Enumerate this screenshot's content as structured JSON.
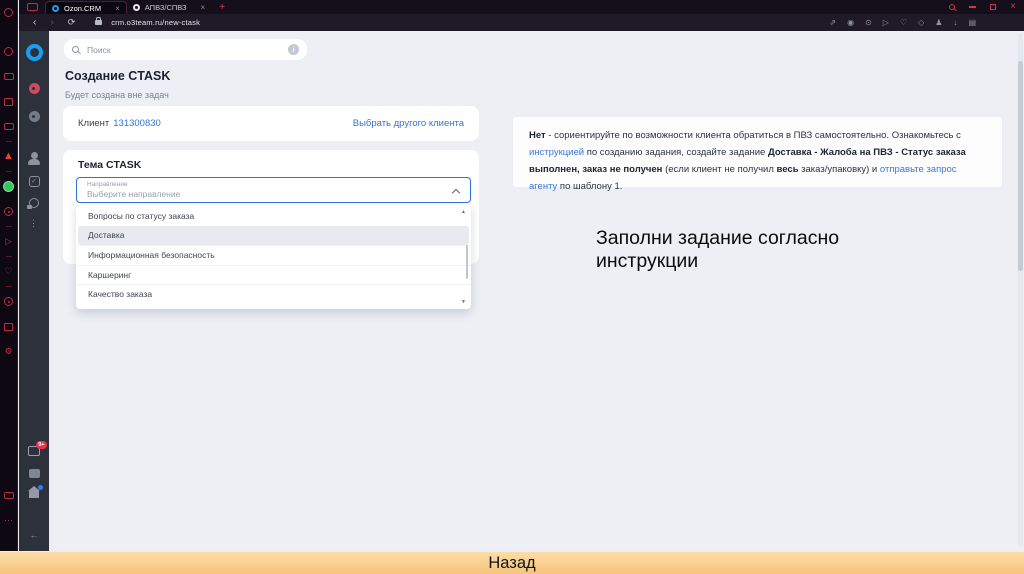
{
  "browser": {
    "tabs": [
      {
        "title": "Ozon.CRM",
        "close": "×"
      },
      {
        "title": "АПВЗ/СПВЗ",
        "close": "×"
      }
    ],
    "new_tab_label": "+",
    "controls": {
      "minimize": "–",
      "close": "×"
    },
    "nav": {
      "back": "‹",
      "forward": "›",
      "reload": "⟳",
      "url": "crm.o3team.ru/new-ctask"
    },
    "toolbar_icons": [
      "⇗",
      "◉",
      "⊙",
      "▷",
      "♡",
      "◇",
      "♟",
      "↓",
      "▤"
    ]
  },
  "rail": {
    "flame": "▲",
    "gear": "⚙",
    "dots": "⋯"
  },
  "app_rail": {
    "badge_count": "9+",
    "more_dots": "⋮",
    "boxcheck": "✓",
    "exit": "←"
  },
  "app": {
    "search_placeholder": "Поиск",
    "search_info": "i",
    "page_title": "Создание CTASK",
    "page_subtitle": "Будет создана вне задач",
    "client": {
      "label": "Клиент",
      "id": "131300830",
      "change_link": "Выбрать другого клиента"
    },
    "topic": {
      "title": "Тема CTASK",
      "select_label": "Направление",
      "select_placeholder": "Выберите направление",
      "options": [
        "Вопросы по статусу заказа",
        "Доставка",
        "Информационная безопасность",
        "Каршеринг",
        "Качество заказа"
      ],
      "highlighted_option": "Доставка",
      "scroll_up": "▲",
      "scroll_down": "▼"
    }
  },
  "instruction": {
    "segments": [
      {
        "text": "Нет",
        "style": "bold"
      },
      {
        "text": " - сориентируйте по возможности клиента обратиться в ПВЗ самостоятельно. Ознакомьтесь с ",
        "style": "normal"
      },
      {
        "text": "инструкцией",
        "style": "link"
      },
      {
        "text": " по созданию задания, создайте задание ",
        "style": "normal"
      },
      {
        "text": "Доставка - Жалоба на ПВЗ - Статус заказа выполнен, заказ не получен",
        "style": "bold"
      },
      {
        "text": " (если клиент не получил ",
        "style": "normal"
      },
      {
        "text": "весь",
        "style": "bold"
      },
      {
        "text": " заказ/упаковку) и ",
        "style": "normal"
      },
      {
        "text": "отправьте запрос агенту",
        "style": "link"
      },
      {
        "text": " по шаблону 1.",
        "style": "normal"
      }
    ]
  },
  "annotation": {
    "text": "Заполни задание согласно инструкции"
  },
  "footer": {
    "back_label": "Назад"
  },
  "colors": {
    "accent_red": "#cf3550",
    "link_blue": "#3573d6",
    "select_border_blue": "#2f6fe0",
    "ozon_blue": "#15a0f5",
    "footer_orange": "#f9cd8f",
    "rail_green": "#35c759",
    "badge_red": "#e8334f"
  }
}
